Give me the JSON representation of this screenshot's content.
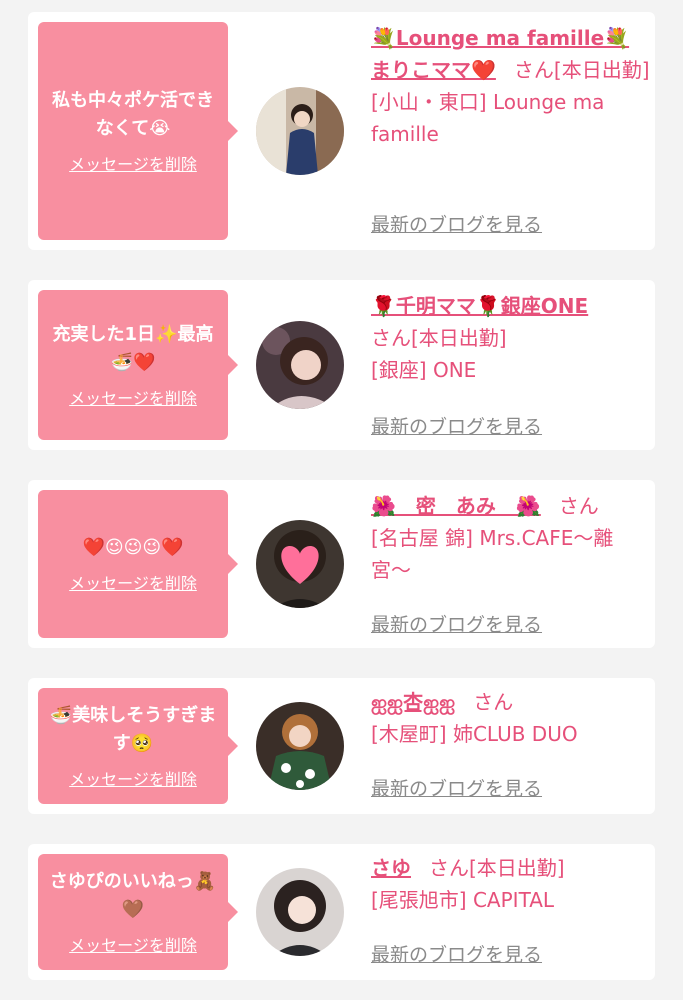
{
  "cards": [
    {
      "message": "私も中々ポケ活できなくて😭",
      "delete_label": "メッセージを削除",
      "shop_title": "💐Lounge ma famille💐",
      "name": "まりこママ❤️",
      "san": "さん",
      "status": "[本日出勤]",
      "location": "[小山・東口] Lounge ma famille",
      "blog_label": "最新のブログを見る",
      "avatar_icon": "woman-kimono-avatar"
    },
    {
      "message": "充実した1日✨最高🍜❤️",
      "delete_label": "メッセージを削除",
      "name": "🌹千明ママ🌹銀座ONE",
      "san": "さん",
      "status": "[本日出勤]",
      "location": "[銀座] ONE",
      "blog_label": "最新のブログを見る",
      "avatar_icon": "woman-portrait-avatar"
    },
    {
      "message": "❤️😉😉😉❤️",
      "delete_label": "メッセージを削除",
      "name": "🌺　密　あみ　🌺",
      "san": "さん",
      "status": "",
      "location": "[名古屋 錦] Mrs.CAFE〜離宮〜",
      "blog_label": "最新のブログを見る",
      "avatar_icon": "heart-face-avatar"
    },
    {
      "message": "🍜美味しそうすぎます🥺",
      "delete_label": "メッセージを削除",
      "name": "ஐஐ杏ஐஐ",
      "san": "さん",
      "status": "",
      "location": "[木屋町] 姉CLUB DUO",
      "blog_label": "最新のブログを見る",
      "avatar_icon": "woman-yukata-avatar"
    },
    {
      "message": "さゆぴのいいねっ🧸🤎",
      "delete_label": "メッセージを削除",
      "name": "さゆ",
      "san": "さん",
      "status": "[本日出勤]",
      "location": "[尾張旭市] CAPITAL",
      "blog_label": "最新のブログを見る",
      "avatar_icon": "woman-selfie-avatar"
    }
  ],
  "colors": {
    "bubble": "#f88fa0",
    "accent_text": "#e6507a",
    "link_gray": "#8a8a8a",
    "page_bg": "#f3f3f3",
    "card_bg": "#ffffff"
  }
}
